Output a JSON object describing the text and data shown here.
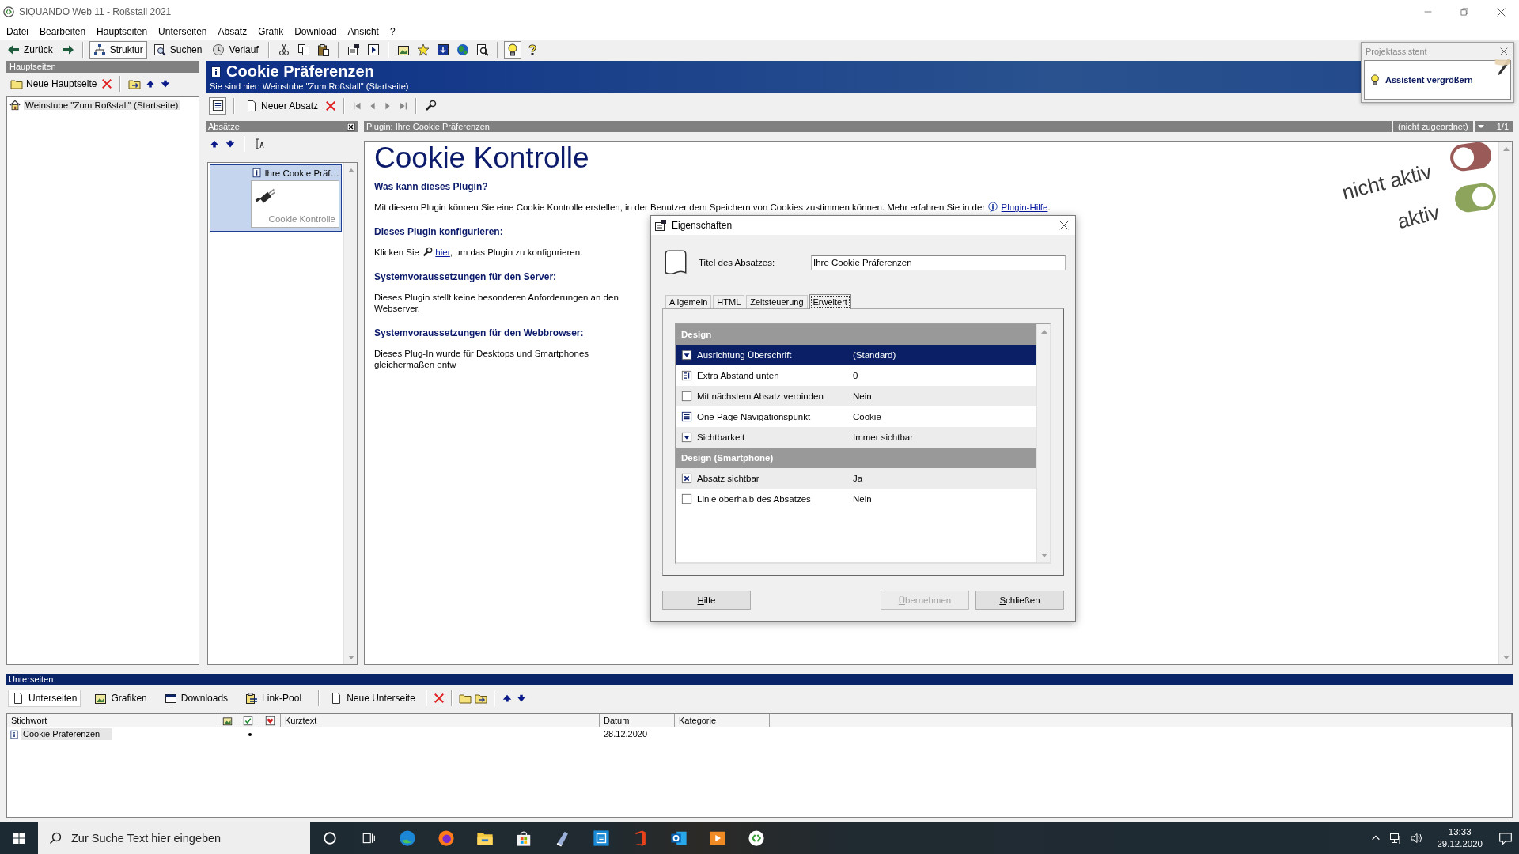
{
  "window": {
    "title": "SIQUANDO Web 11 - Roßstall 2021"
  },
  "menu": [
    "Datei",
    "Bearbeiten",
    "Hauptseiten",
    "Unterseiten",
    "Absatz",
    "Grafik",
    "Download",
    "Ansicht",
    "?"
  ],
  "toolbar": [
    {
      "label": "Zurück",
      "selected": false
    },
    {
      "label": "Struktur",
      "selected": true
    },
    {
      "label": "Suchen",
      "selected": false
    },
    {
      "label": "Verlauf",
      "selected": false
    }
  ],
  "tips_button": {
    "selected": true
  },
  "main_pages": {
    "title": "Hauptseiten",
    "new_button": "Neue Hauptseite",
    "tree": [
      {
        "label": "Weinstube \"Zum Roßstall\" (Startseite)",
        "selected": true
      }
    ]
  },
  "page": {
    "title": "Cookie Präferenzen",
    "breadcrumb": "Sie sind hier: Weinstube \"Zum Roßstall\" (Startseite)",
    "view_button": {
      "selected": true
    },
    "new_paragraph_button": "Neuer Absatz"
  },
  "paragraphs": {
    "title": "Absätze",
    "items": [
      {
        "title": "Ihre Cookie Präf…",
        "caption": "Cookie Kontrolle",
        "selected": true
      }
    ]
  },
  "plugin": {
    "title": "Plugin: Ihre Cookie Präferenzen",
    "assignment": "(nicht zugeordnet)",
    "page_count": "1/1",
    "heading": "Cookie Kontrolle",
    "sections": [
      {
        "heading": "Was kann dieses Plugin?",
        "text": "Mit diesem Plugin können Sie eine Cookie Kontrolle erstellen, in der Benutzer dem Speichern von Cookies zustimmen können. Mehr erfahren Sie in der",
        "link": "Plugin-Hilfe",
        "text_after": "."
      },
      {
        "heading": "Dieses Plugin konfigurieren:",
        "text": "Klicken Sie",
        "link": "hier",
        "text_after": ", um das Plugin zu konfigurieren."
      },
      {
        "heading": "Systemvoraussetzungen für den Server:",
        "text": "Dieses Plugin stellt keine besonderen Anforderungen an den Webserver."
      },
      {
        "heading": "Systemvoraussetzungen für den Webbrowser:",
        "text": "Dieses Plug-In wurde für Desktops und Smartphones gleichermaßen entw"
      }
    ],
    "preview_toggles": [
      {
        "label": "nicht aktiv",
        "on": false,
        "color": "#9a5a57"
      },
      {
        "label": "aktiv",
        "on": true,
        "color": "#8da45c"
      }
    ]
  },
  "dialog": {
    "title": "Eigenschaften",
    "title_label": "Titel des Absatzes:",
    "title_value": "Ihre Cookie Präferenzen",
    "tabs": [
      {
        "label": "Allgemein",
        "selected": false
      },
      {
        "label": "HTML",
        "selected": false
      },
      {
        "label": "Zeitsteuerung",
        "selected": false
      },
      {
        "label": "Erweitert",
        "selected": true
      }
    ],
    "groups": [
      {
        "title": "Design",
        "rows": [
          {
            "kind": "dropdown",
            "label": "Ausrichtung Überschrift",
            "value": "(Standard)",
            "selected": true
          },
          {
            "kind": "number",
            "label": "Extra Abstand unten",
            "value": "0",
            "selected": false
          },
          {
            "kind": "checkbox",
            "checked": false,
            "label": "Mit nächstem Absatz verbinden",
            "value": "Nein",
            "selected": false
          },
          {
            "kind": "list",
            "label": "One Page Navigationspunkt",
            "value": "Cookie",
            "selected": false
          },
          {
            "kind": "dropdown",
            "label": "Sichtbarkeit",
            "value": "Immer sichtbar",
            "selected": false
          }
        ]
      },
      {
        "title": "Design (Smartphone)",
        "rows": [
          {
            "kind": "checkbox",
            "checked": true,
            "label": "Absatz sichtbar",
            "value": "Ja",
            "selected": false
          },
          {
            "kind": "checkbox",
            "checked": false,
            "label": "Linie oberhalb des Absatzes",
            "value": "Nein",
            "selected": false
          }
        ]
      }
    ],
    "buttons": [
      {
        "label": "Hilfe",
        "disabled": false
      },
      {
        "label": "Übernehmen",
        "disabled": true
      },
      {
        "label": "Schließen",
        "disabled": false
      }
    ]
  },
  "assistant": {
    "title": "Projektassistent",
    "button": "Assistent vergrößern"
  },
  "subpages": {
    "title": "Unterseiten",
    "tabs": [
      {
        "label": "Unterseiten",
        "selected": true
      },
      {
        "label": "Grafiken",
        "selected": false
      },
      {
        "label": "Downloads",
        "selected": false
      },
      {
        "label": "Link-Pool",
        "selected": false
      }
    ],
    "new_button": "Neue Unterseite",
    "columns": [
      "Stichwort",
      "Kurztext",
      "Datum",
      "Kategorie"
    ],
    "rows": [
      {
        "keyword": "Cookie Präferenzen",
        "active": true,
        "date": "28.12.2020",
        "selected": true
      }
    ]
  },
  "taskbar": {
    "search": {
      "placeholder": "Zur Suche Text hier eingeben"
    },
    "time": "13:33",
    "date": "29.12.2020"
  }
}
